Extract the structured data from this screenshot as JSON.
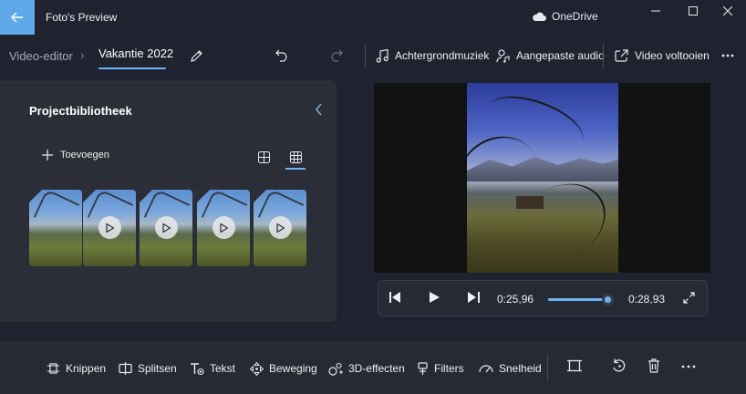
{
  "titlebar": {
    "app_title": "Foto's Preview",
    "cloud_label": "OneDrive"
  },
  "toolbar": {
    "breadcrumb_root": "Video-editor",
    "breadcrumb_separator": "›",
    "project_name": "Vakantie 2022",
    "background_music_label": "Achtergrondmuziek",
    "custom_audio_label": "Aangepaste audio",
    "finish_video_label": "Video voltooien"
  },
  "library": {
    "title": "Projectbibliotheek",
    "add_label": "Toevoegen",
    "active_view": "grid-small"
  },
  "player": {
    "current_time": "0:25,96",
    "total_time": "0:28,93",
    "progress": 0.9
  },
  "bottom_toolbar": {
    "trim_label": "Knippen",
    "split_label": "Splitsen",
    "text_label": "Tekst",
    "motion_label": "Beweging",
    "effects_3d_label": "3D-effecten",
    "filters_label": "Filters",
    "speed_label": "Snelheid"
  },
  "colors": {
    "accent": "#6fb4f2",
    "back_button": "#5fa9e8",
    "background": "#1f2330",
    "panel": "#2b2e36"
  }
}
